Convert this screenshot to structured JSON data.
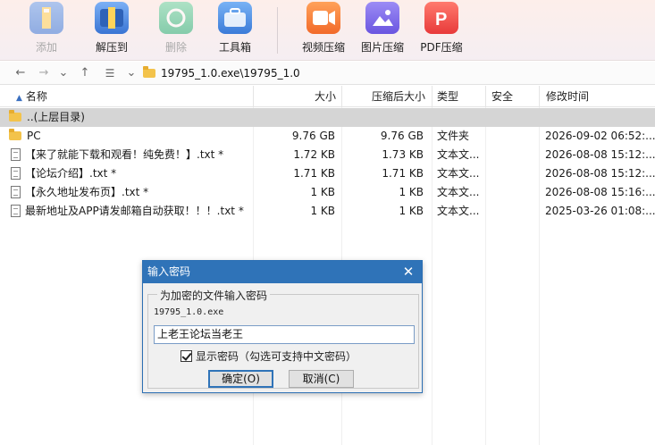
{
  "toolbar": {
    "add": "添加",
    "extract": "解压到",
    "delete": "删除",
    "tools": "工具箱",
    "video": "视频压缩",
    "image": "图片压缩",
    "pdf": "PDF压缩"
  },
  "address": {
    "path": "19795_1.0.exe\\19795_1.0"
  },
  "columns": {
    "name": "名称",
    "size": "大小",
    "packed": "压缩后大小",
    "type": "类型",
    "security": "安全",
    "modified": "修改时间"
  },
  "rows": [
    {
      "name": "..(上层目录)",
      "size": "",
      "packed": "",
      "type": "",
      "modified": ""
    },
    {
      "name": "PC",
      "size": "9.76 GB",
      "packed": "9.76 GB",
      "type": "文件夹",
      "modified": "2026-09-02 06:52:..."
    },
    {
      "name": "【来了就能下载和观看！纯免费！】.txt *",
      "size": "1.72 KB",
      "packed": "1.73 KB",
      "type": "文本文...",
      "modified": "2026-08-08 15:12:..."
    },
    {
      "name": "【论坛介绍】.txt *",
      "size": "1.71 KB",
      "packed": "1.71 KB",
      "type": "文本文...",
      "modified": "2026-08-08 15:12:..."
    },
    {
      "name": "【永久地址发布页】.txt *",
      "size": "1 KB",
      "packed": "1 KB",
      "type": "文本文...",
      "modified": "2026-08-08 15:16:..."
    },
    {
      "name": "最新地址及APP请发邮箱自动获取！！！.txt *",
      "size": "1 KB",
      "packed": "1 KB",
      "type": "文本文...",
      "modified": "2025-03-26 01:08:..."
    }
  ],
  "dialog": {
    "title": "输入密码",
    "group_label": "为加密的文件输入密码",
    "filename": "19795_1.0.exe",
    "password": "上老王论坛当老王",
    "show_password": "显示密码（勾选可支持中文密码）",
    "ok": "确定(O)",
    "cancel": "取消(C)"
  },
  "colors": {
    "dialog_title": "#2f73b8",
    "selected_row": "#d5d5d5",
    "folder": "#f3c34b"
  }
}
